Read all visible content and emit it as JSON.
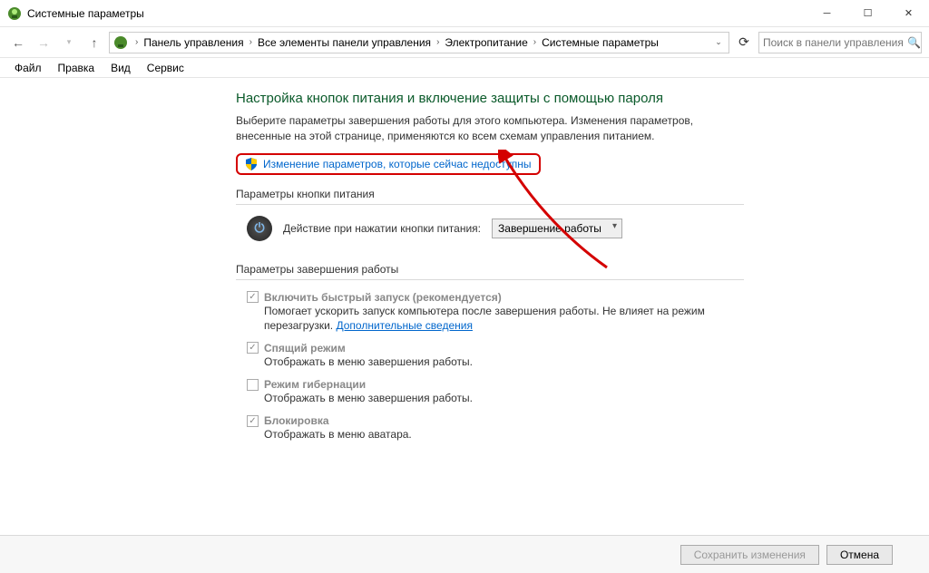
{
  "window": {
    "title": "Системные параметры"
  },
  "breadcrumb": {
    "seg1": "Панель управления",
    "seg2": "Все элементы панели управления",
    "seg3": "Электропитание",
    "seg4": "Системные параметры"
  },
  "search": {
    "placeholder": "Поиск в панели управления"
  },
  "menu": {
    "file": "Файл",
    "edit": "Правка",
    "view": "Вид",
    "service": "Сервис"
  },
  "page": {
    "title": "Настройка кнопок питания и включение защиты с помощью пароля",
    "desc": "Выберите параметры завершения работы для этого компьютера. Изменения параметров, внесенные на этой странице, применяются ко всем схемам управления питанием.",
    "change_link": "Изменение параметров, которые сейчас недоступны"
  },
  "power_button": {
    "section": "Параметры кнопки питания",
    "label": "Действие при нажатии кнопки питания:",
    "selected": "Завершение работы"
  },
  "shutdown": {
    "section": "Параметры завершения работы",
    "fast": {
      "title": "Включить быстрый запуск (рекомендуется)",
      "desc": "Помогает ускорить запуск компьютера после завершения работы. Не влияет на режим перезагрузки. ",
      "link": "Дополнительные сведения"
    },
    "sleep": {
      "title": "Спящий режим",
      "desc": "Отображать в меню завершения работы."
    },
    "hibernate": {
      "title": "Режим гибернации",
      "desc": "Отображать в меню завершения работы."
    },
    "lock": {
      "title": "Блокировка",
      "desc": "Отображать в меню аватара."
    }
  },
  "buttons": {
    "save": "Сохранить изменения",
    "cancel": "Отмена"
  }
}
